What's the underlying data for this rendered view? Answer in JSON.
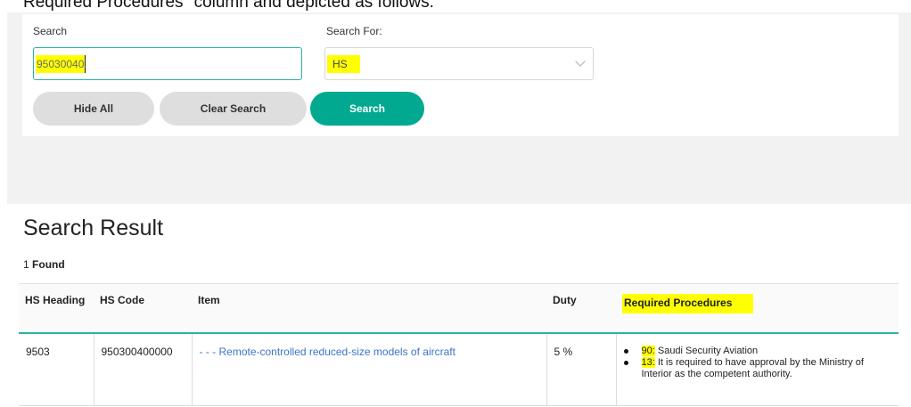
{
  "caption": "Required Procedures\" column and depicted as follows:",
  "search_form": {
    "search_label": "Search",
    "search_value": "95030040",
    "search_for_label": "Search For:",
    "search_for_value": "HS",
    "hide_all_label": "Hide All",
    "clear_search_label": "Clear Search",
    "search_button_label": "Search"
  },
  "results": {
    "title": "Search Result",
    "found_count": "1",
    "found_label": "Found",
    "columns": {
      "hs_heading": "HS Heading",
      "hs_code": "HS Code",
      "item": "Item",
      "duty": "Duty",
      "required_procedures": "Required Procedures"
    },
    "rows": [
      {
        "hs_heading": "9503",
        "hs_code": "950300400000",
        "item": "- - - Remote-controlled reduced-size models of aircraft",
        "duty": "5 %",
        "procedures": [
          {
            "code": "90:",
            "text": "Saudi Security Aviation"
          },
          {
            "code": "13:",
            "text": "It is required to have approval by the Ministry of Interior as the competent authority."
          }
        ]
      }
    ]
  },
  "colors": {
    "accent": "#00a98f",
    "highlight": "#ffff00",
    "link": "#3b74c9"
  }
}
